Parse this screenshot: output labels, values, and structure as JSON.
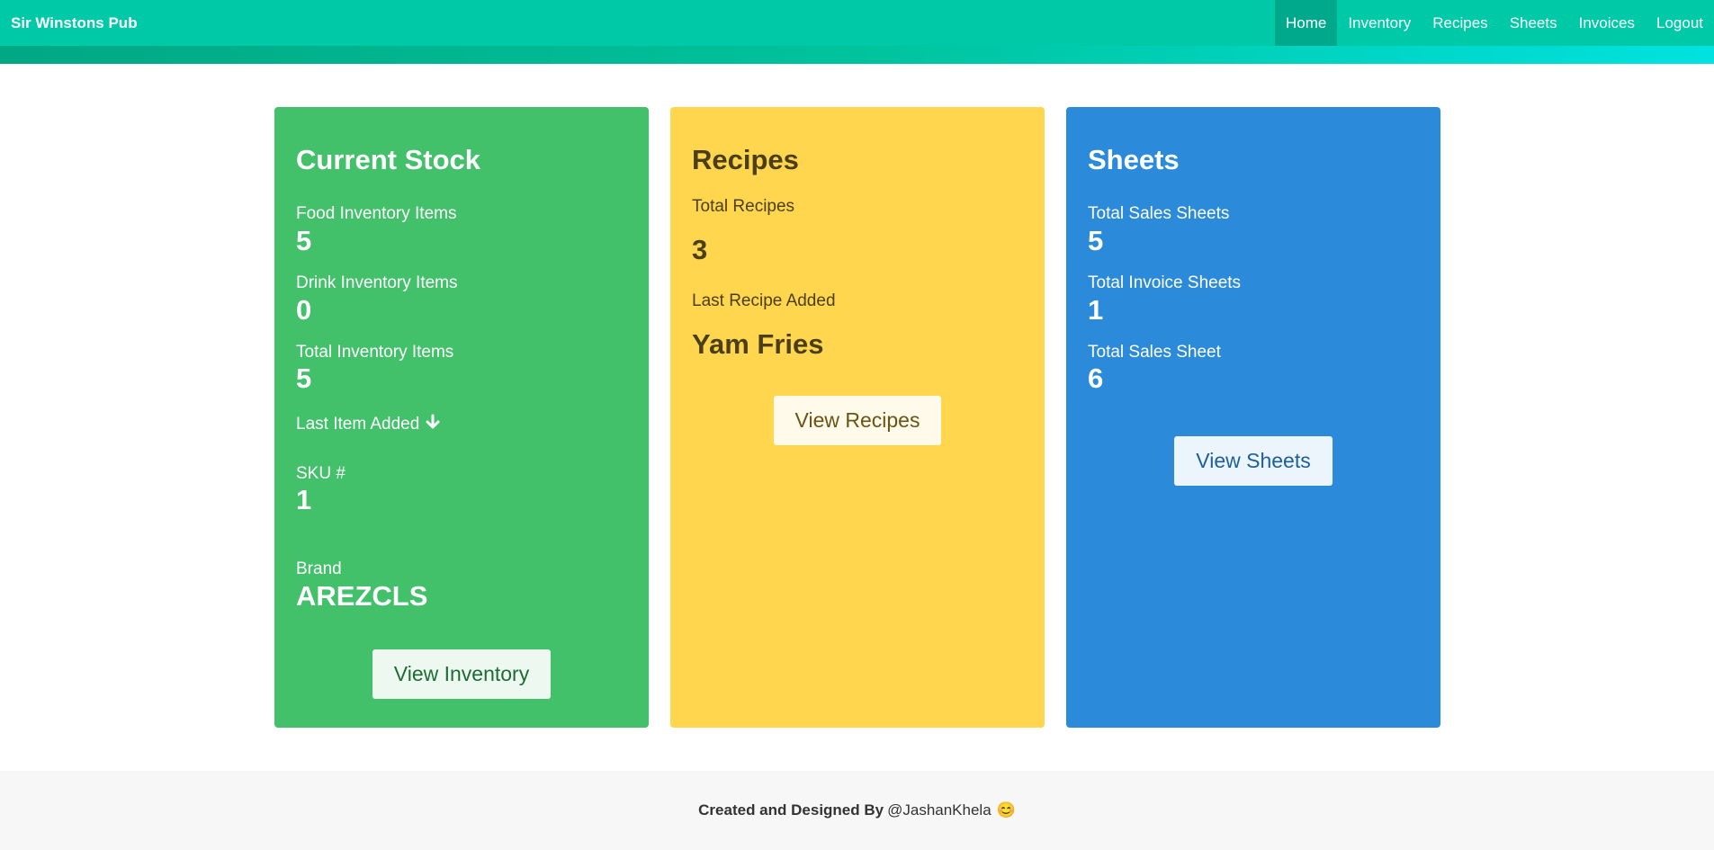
{
  "nav": {
    "brand": "Sir Winstons Pub",
    "items": [
      "Home",
      "Inventory",
      "Recipes",
      "Sheets",
      "Invoices",
      "Logout"
    ]
  },
  "stock": {
    "title": "Current Stock",
    "food_label": "Food Inventory Items",
    "food_value": "5",
    "drink_label": "Drink Inventory Items",
    "drink_value": "0",
    "total_label": "Total Inventory Items",
    "total_value": "5",
    "last_label": "Last Item Added",
    "sku_label": "SKU #",
    "sku_value": "1",
    "brand_label": "Brand",
    "brand_value": "AREZCLS",
    "button": "View Inventory"
  },
  "recipes": {
    "title": "Recipes",
    "total_label": "Total Recipes",
    "total_value": "3",
    "last_label": "Last Recipe Added",
    "last_value": "Yam Fries",
    "button": "View Recipes"
  },
  "sheets": {
    "title": "Sheets",
    "sales_label": "Total Sales Sheets",
    "sales_value": "5",
    "invoice_label": "Total Invoice Sheets",
    "invoice_value": "1",
    "sheet_label": "Total Sales Sheet",
    "sheet_value": "6",
    "button": "View Sheets"
  },
  "footer": {
    "prefix": "Created and Designed By",
    "author": "@JashanKhela",
    "emoji": "😊"
  },
  "colors": {
    "nav": "#00c9a7",
    "green_card": "#42c06a",
    "yellow_card": "#ffd64d",
    "blue_card": "#2b8ad9"
  },
  "icons": {
    "last_item": "arrow-down-icon"
  }
}
